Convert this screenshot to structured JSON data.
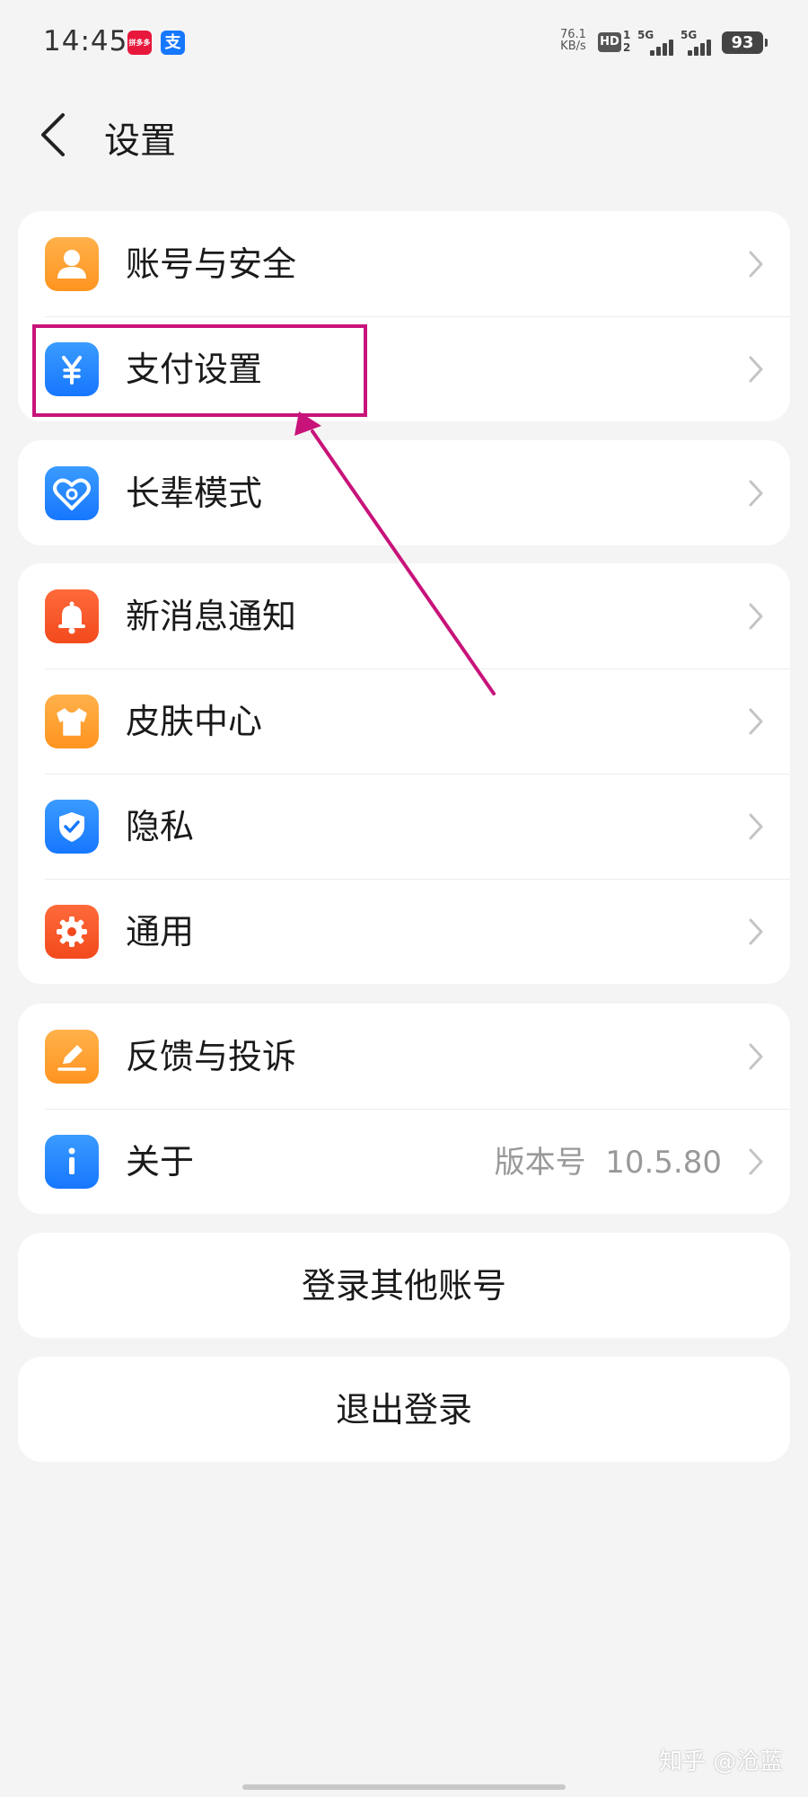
{
  "status_bar": {
    "time": "14:45",
    "app1_text": "拼多多",
    "app2_text": "支",
    "net_rate": "76.1",
    "net_unit": "KB/s",
    "hd": "HD",
    "sim1": "1",
    "sim2": "2",
    "signal1_tag": "5G",
    "signal2_tag": "5G",
    "battery": "93"
  },
  "header": {
    "title": "设置"
  },
  "groups": [
    {
      "items": [
        {
          "label": "账号与安全",
          "icon": "person-icon"
        },
        {
          "label": "支付设置",
          "icon": "yen-icon"
        }
      ]
    },
    {
      "items": [
        {
          "label": "长辈模式",
          "icon": "heart-icon"
        }
      ]
    },
    {
      "items": [
        {
          "label": "新消息通知",
          "icon": "bell-icon"
        },
        {
          "label": "皮肤中心",
          "icon": "tshirt-icon"
        },
        {
          "label": "隐私",
          "icon": "shield-check-icon"
        },
        {
          "label": "通用",
          "icon": "gear-icon"
        }
      ]
    },
    {
      "items": [
        {
          "label": "反馈与投诉",
          "icon": "pencil-icon"
        },
        {
          "label": "关于",
          "icon": "info-icon",
          "value_prefix": "版本号",
          "value": "10.5.80"
        }
      ]
    }
  ],
  "actions": {
    "switch_account": "登录其他账号",
    "logout": "退出登录"
  },
  "watermark": "知乎 @沧蓝",
  "colors": {
    "annotation": "#c8137a",
    "orange": "#ff9f2e",
    "blue": "#1677ff",
    "red": "#f24a1d"
  }
}
